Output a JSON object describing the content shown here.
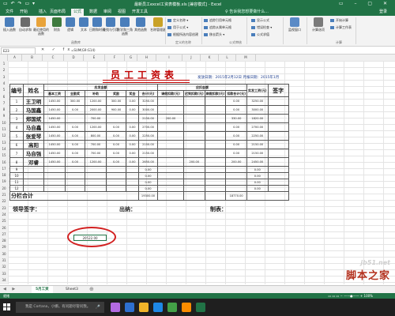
{
  "window": {
    "title": "最新员工excel工资表模板.xls [兼容模式] - Excel",
    "quick_access": "▭ ↶ ↷ ▭ ▾",
    "controls": "▭ – ▢ ✕"
  },
  "tabs": [
    "文件",
    "开始",
    "插入",
    "页面布局",
    "公式",
    "数据",
    "审阅",
    "视图",
    "开发工具"
  ],
  "active_tab": "公式",
  "tell_me": "♀ 告诉我您想要做什么...",
  "login": "登录",
  "ribbon": {
    "buttons": [
      {
        "label": "插入函数",
        "icon": "fx-icon",
        "color": "#4a7ebb"
      },
      {
        "label": "自动求和",
        "icon": "sum-icon",
        "color": "#6a6a6a"
      },
      {
        "label": "最近使用的函数",
        "icon": "star-icon",
        "color": "#e8a33a"
      },
      {
        "label": "财务",
        "icon": "book-icon",
        "color": "#3e7a3e"
      },
      {
        "label": "逻辑",
        "icon": "question-icon",
        "color": "#4a7ebb"
      },
      {
        "label": "文本",
        "icon": "text-icon",
        "color": "#4a7ebb"
      },
      {
        "label": "日期和时间",
        "icon": "clock-icon",
        "color": "#4a7ebb"
      },
      {
        "label": "查找与引用",
        "icon": "lookup-icon",
        "color": "#4a7ebb"
      },
      {
        "label": "数学和三角函数",
        "icon": "theta-icon",
        "color": "#4a7ebb"
      },
      {
        "label": "其他函数",
        "icon": "more-icon",
        "color": "#4a7ebb"
      },
      {
        "label": "名称管理器",
        "icon": "tag-icon",
        "color": "#c9a227"
      }
    ],
    "small": [
      {
        "text": "定义名称 ▾"
      },
      {
        "text": "用于公式 ▾"
      },
      {
        "text": "根据所选内容创建"
      },
      {
        "text": "追踪引用单元格"
      },
      {
        "text": "追踪从属单元格"
      },
      {
        "text": "移去箭头 ▾"
      },
      {
        "text": "显示公式"
      },
      {
        "text": "错误检查 ▾"
      },
      {
        "text": "公式求值"
      }
    ],
    "watch": "监视窗口",
    "calc": "计算选项",
    "calc_small": [
      "开始计算",
      "计算工作表"
    ],
    "group_labels": [
      "函数库",
      "定义的名称",
      "公式审核",
      "计算"
    ]
  },
  "formula_bar": {
    "name_box": "E23",
    "icons": "✕ ✓ fx",
    "formula": "=SUM(G9:G14)"
  },
  "columns": [
    "A",
    "B",
    "C",
    "D",
    "E",
    "F",
    "G",
    "H",
    "I",
    "J",
    "K",
    "L",
    "M"
  ],
  "rows": [
    "1",
    "2",
    "3",
    "4",
    "5",
    "6",
    "7",
    "8",
    "9",
    "10",
    "11",
    "12",
    "13",
    "14",
    "15",
    "16",
    "17",
    "18",
    "19",
    "20",
    "21",
    "22",
    "23",
    "24",
    "25",
    "26",
    "27",
    "28",
    "29",
    "30",
    "31",
    "32",
    "33",
    "34"
  ],
  "sheet": {
    "title": "员工工资表",
    "date_line": "发放日期：2015年2月12日  月报日期：2015年1月",
    "headers": {
      "no": "编号",
      "name": "姓名",
      "payable": "应发金额",
      "deduction": "应扣金额",
      "actual": "实发工资(元)",
      "sign": "签字",
      "sub": [
        "基本工资",
        "全勤奖",
        "补助",
        "奖励",
        "奖金",
        "合计(元)",
        "请假扣款(元)",
        "迟到扣款(元)",
        "病假扣款(元)",
        "扣款合计(元)"
      ]
    },
    "rows": [
      {
        "no": "1",
        "name": "王卫明",
        "v": [
          "1450.00",
          "300.00",
          "1200.00",
          "300.00",
          "0.00",
          "3250.00",
          "",
          "",
          "",
          "0.00",
          "3250.00"
        ]
      },
      {
        "no": "2",
        "name": "马国鑫",
        "v": [
          "1450.00",
          "0.00",
          "2000.00",
          "900.00",
          "0.00",
          "3000.00",
          "",
          "",
          "",
          "0.00",
          "3000.00"
        ]
      },
      {
        "no": "3",
        "name": "郑国斌",
        "v": [
          "1450.00",
          "",
          "700.00",
          "",
          "",
          "2150.00",
          "200.00",
          "",
          "",
          "330.00",
          "1820.00"
        ]
      },
      {
        "no": "4",
        "name": "马自鑫",
        "v": [
          "1450.00",
          "0.00",
          "1200.00",
          "0.00",
          "0.00",
          "2700.00",
          "",
          "",
          "",
          "0.00",
          "2700.00"
        ]
      },
      {
        "no": "5",
        "name": "张爱琴",
        "v": [
          "1450.00",
          "0.00",
          "800.00",
          "0.00",
          "0.00",
          "2250.00",
          "",
          "",
          "",
          "0.00",
          "2250.00"
        ]
      },
      {
        "no": "6",
        "name": "高阳",
        "v": [
          "1450.00",
          "0.00",
          "700.00",
          "0.00",
          "0.00",
          "2150.00",
          "",
          "",
          "",
          "0.00",
          "2150.00"
        ]
      },
      {
        "no": "7",
        "name": "马自强",
        "v": [
          "1450.00",
          "0.00",
          "700.00",
          "0.00",
          "0.00",
          "2150.00",
          "",
          "",
          "",
          "0.00",
          "2150.00"
        ]
      },
      {
        "no": "8",
        "name": "邓睿",
        "v": [
          "1450.00",
          "0.00",
          "1200.00",
          "0.00",
          "0.00",
          "2650.00",
          "",
          "200.00",
          "",
          "200.00",
          "2450.00"
        ]
      },
      {
        "no": "9",
        "name": "",
        "v": [
          "",
          "",
          "",
          "",
          "",
          "0.00",
          "",
          "",
          "",
          "",
          "0.00"
        ]
      },
      {
        "no": "10",
        "name": "",
        "v": [
          "",
          "",
          "",
          "",
          "",
          "0.00",
          "",
          "",
          "",
          "",
          "0.00"
        ]
      },
      {
        "no": "11",
        "name": "",
        "v": [
          "",
          "",
          "",
          "",
          "",
          "0.00",
          "",
          "",
          "",
          "",
          "0.00"
        ]
      },
      {
        "no": "12",
        "name": "",
        "v": [
          "",
          "",
          "",
          "",
          "",
          "0.00",
          "",
          "",
          "",
          "",
          "0.00"
        ]
      }
    ],
    "total_label": "分栏合计",
    "total_values": [
      "19300.00",
      "",
      "",
      "",
      "18770.00"
    ],
    "signatures": [
      "领导签字：",
      "出纳：",
      "制表："
    ],
    "selected_cell_value": "20522.00"
  },
  "sheet_tabs": [
    "5月工资",
    "Sheet3"
  ],
  "active_sheet": "5月工资",
  "status": {
    "left": "就绪",
    "zoom": "▭ ▭ ▭  −  ——●——  +  100%"
  },
  "taskbar": {
    "search": "我是 Cortana，小娜。有问题尽管问我。",
    "mic": "🎤",
    "icon_colors": [
      "#b36ae2",
      "#2e6fcf",
      "#f0b429",
      "#1e88e5",
      "#43a047",
      "#fb8c00",
      "#217346"
    ]
  },
  "watermark": {
    "domain": "jb51.net",
    "cn": "脚本之家"
  }
}
